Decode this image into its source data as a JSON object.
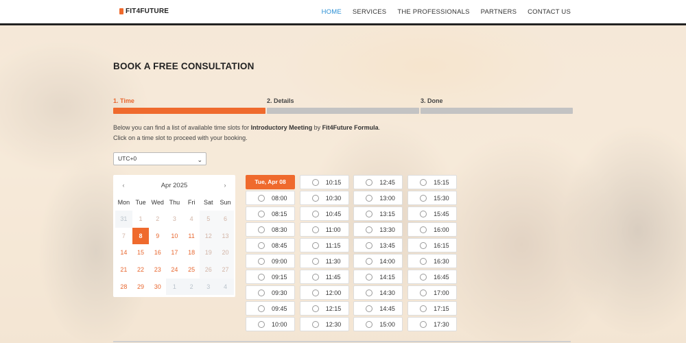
{
  "header": {
    "logo_text": "FIT4FUTURE",
    "nav": [
      {
        "label": "HOME",
        "active": true
      },
      {
        "label": "SERVICES",
        "active": false
      },
      {
        "label": "THE PROFESSIONALS",
        "active": false
      },
      {
        "label": "PARTNERS",
        "active": false
      },
      {
        "label": "CONTACT US",
        "active": false
      }
    ]
  },
  "page": {
    "title": "BOOK A FREE CONSULTATION",
    "steps": [
      {
        "label": "1. Time",
        "active": true
      },
      {
        "label": "2. Details",
        "active": false
      },
      {
        "label": "3. Done",
        "active": false
      }
    ],
    "info": {
      "line1_prefix": "Below you can find a list of available time slots for ",
      "service": "Introductory Meeting",
      "line1_mid": " by ",
      "staff": "Fit4Future Formula",
      "line1_suffix": ".",
      "line2": "Click on a time slot to proceed with your booking."
    },
    "timezone": "UTC+0"
  },
  "calendar": {
    "month": "Apr 2025",
    "prev_icon": "chevron-left-icon",
    "next_icon": "chevron-right-icon",
    "weekdays": [
      "Mon",
      "Tue",
      "Wed",
      "Thu",
      "Fri",
      "Sat",
      "Sun"
    ],
    "weeks": [
      [
        {
          "d": "31",
          "s": "other"
        },
        {
          "d": "1",
          "s": "muted"
        },
        {
          "d": "2",
          "s": "muted"
        },
        {
          "d": "3",
          "s": "muted"
        },
        {
          "d": "4",
          "s": "muted"
        },
        {
          "d": "5",
          "s": "muted-wknd"
        },
        {
          "d": "6",
          "s": "muted-wknd"
        }
      ],
      [
        {
          "d": "7",
          "s": "muted"
        },
        {
          "d": "8",
          "s": "selected"
        },
        {
          "d": "9",
          "s": "avail"
        },
        {
          "d": "10",
          "s": "avail"
        },
        {
          "d": "11",
          "s": "avail"
        },
        {
          "d": "12",
          "s": "muted-wknd"
        },
        {
          "d": "13",
          "s": "muted-wknd"
        }
      ],
      [
        {
          "d": "14",
          "s": "avail"
        },
        {
          "d": "15",
          "s": "avail"
        },
        {
          "d": "16",
          "s": "avail"
        },
        {
          "d": "17",
          "s": "avail"
        },
        {
          "d": "18",
          "s": "avail"
        },
        {
          "d": "19",
          "s": "muted-wknd"
        },
        {
          "d": "20",
          "s": "muted-wknd"
        }
      ],
      [
        {
          "d": "21",
          "s": "avail"
        },
        {
          "d": "22",
          "s": "avail"
        },
        {
          "d": "23",
          "s": "avail"
        },
        {
          "d": "24",
          "s": "avail"
        },
        {
          "d": "25",
          "s": "avail"
        },
        {
          "d": "26",
          "s": "muted-wknd"
        },
        {
          "d": "27",
          "s": "muted-wknd"
        }
      ],
      [
        {
          "d": "28",
          "s": "avail"
        },
        {
          "d": "29",
          "s": "avail"
        },
        {
          "d": "30",
          "s": "avail"
        },
        {
          "d": "1",
          "s": "other"
        },
        {
          "d": "2",
          "s": "other"
        },
        {
          "d": "3",
          "s": "other"
        },
        {
          "d": "4",
          "s": "other"
        }
      ]
    ]
  },
  "slots": {
    "day_label": "Tue, Apr 08",
    "columns": [
      [
        "08:00",
        "08:15",
        "08:30",
        "08:45",
        "09:00",
        "09:15",
        "09:30",
        "09:45",
        "10:00"
      ],
      [
        "10:15",
        "10:30",
        "10:45",
        "11:00",
        "11:15",
        "11:30",
        "11:45",
        "12:00",
        "12:15",
        "12:30"
      ],
      [
        "12:45",
        "13:00",
        "13:15",
        "13:30",
        "13:45",
        "14:00",
        "14:15",
        "14:30",
        "14:45",
        "15:00"
      ],
      [
        "15:15",
        "15:30",
        "15:45",
        "16:00",
        "16:15",
        "16:30",
        "16:45",
        "17:00",
        "17:15",
        "17:30"
      ]
    ]
  },
  "colors": {
    "accent": "#ef6a2d",
    "nav_active": "#2a8fd4"
  }
}
